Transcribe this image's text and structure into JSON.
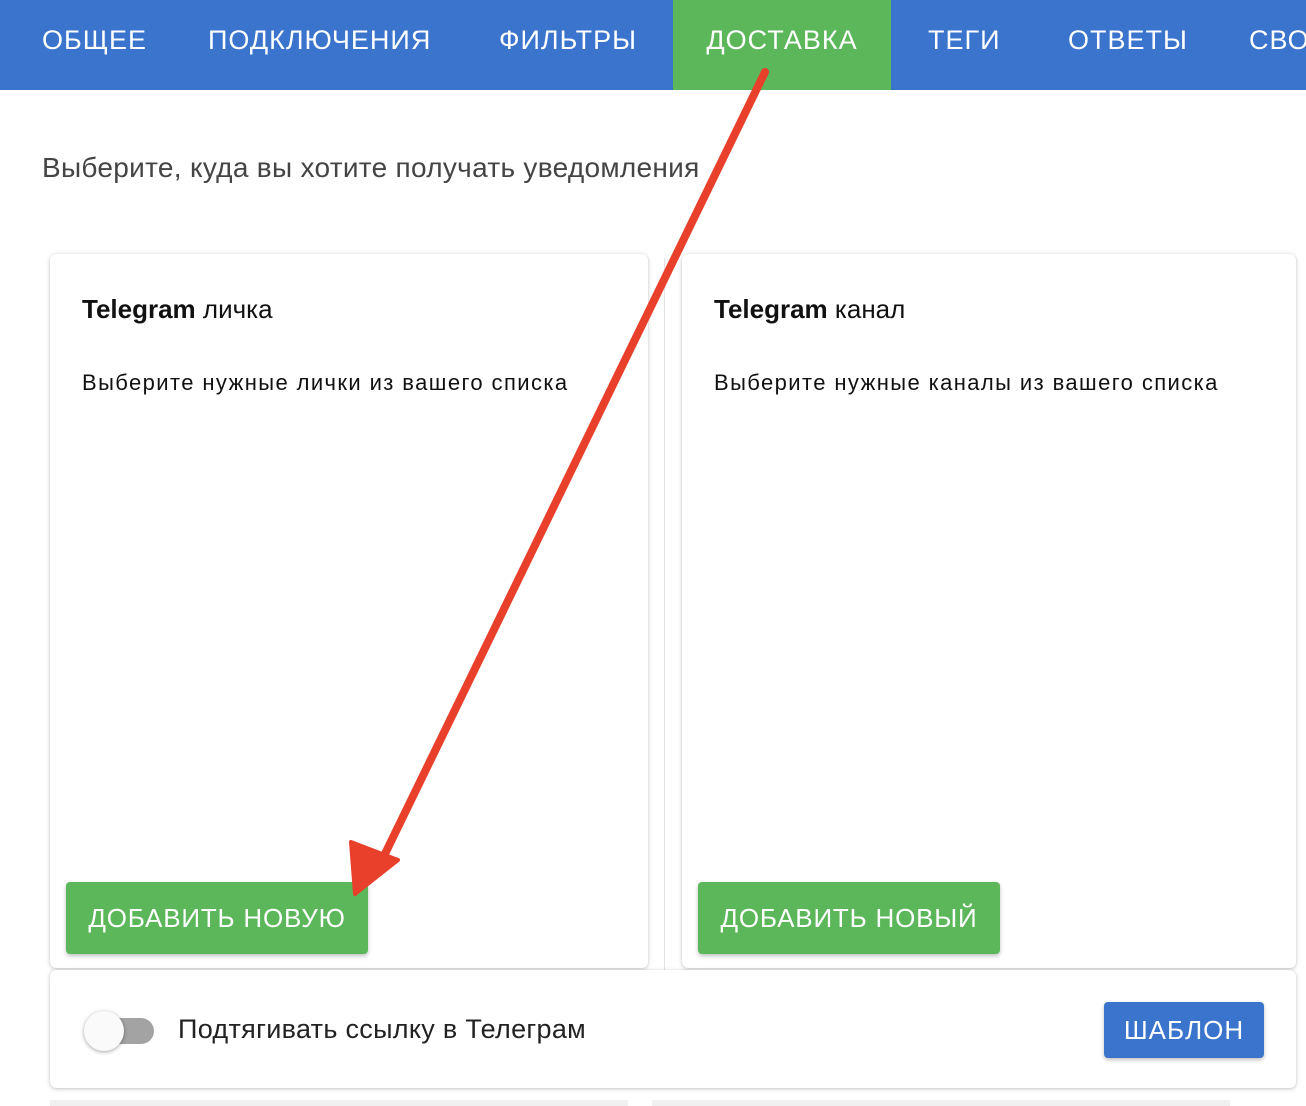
{
  "nav": {
    "tabs": [
      {
        "label": "ОБЩЕЕ",
        "active": false
      },
      {
        "label": "ПОДКЛЮЧЕНИЯ",
        "active": false
      },
      {
        "label": "ФИЛЬТРЫ",
        "active": false
      },
      {
        "label": "ДОСТАВКА",
        "active": true
      },
      {
        "label": "ТЕГИ",
        "active": false
      },
      {
        "label": "ОТВЕТЫ",
        "active": false
      },
      {
        "label": "СВО",
        "active": false
      }
    ]
  },
  "subtitle": "Выберите, куда вы хотите получать уведомления",
  "cards": [
    {
      "title_brand": "Telegram",
      "title_type": "личка",
      "description": "Выберите нужные лички из вашего списка",
      "button_label": "ДОБАВИТЬ НОВУЮ"
    },
    {
      "title_brand": "Telegram",
      "title_type": "канал",
      "description": "Выберите нужные каналы из вашего списка",
      "button_label": "ДОБАВИТЬ НОВЫЙ"
    }
  ],
  "settings": {
    "toggle_label": "Подтягивать ссылку в Телеграм",
    "toggle_on": false,
    "template_button": "ШАБЛОН"
  },
  "colors": {
    "nav_bg": "#3a74cc",
    "active_tab": "#5bb75a",
    "button_green": "#5bb75a",
    "button_blue": "#3a74cc",
    "annotation_arrow": "#e8402b"
  },
  "annotation": {
    "type": "arrow",
    "from": "tab-delivery",
    "to": "add-new-private-button"
  }
}
